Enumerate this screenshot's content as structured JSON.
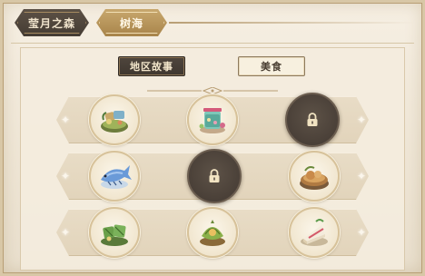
{
  "breadcrumb": {
    "level1": "莹月之森",
    "level2": "树海"
  },
  "tabs": {
    "story": "地区故事",
    "food": "美食",
    "active": "story"
  },
  "grid": {
    "rows": [
      [
        {
          "state": "unlocked",
          "icon": "herbal-dish-icon"
        },
        {
          "state": "unlocked",
          "icon": "jar-preserve-icon"
        },
        {
          "state": "locked",
          "icon": "lock-icon"
        }
      ],
      [
        {
          "state": "unlocked",
          "icon": "grilled-fish-icon"
        },
        {
          "state": "locked",
          "icon": "lock-icon"
        },
        {
          "state": "unlocked",
          "icon": "stew-pot-icon"
        }
      ],
      [
        {
          "state": "unlocked",
          "icon": "leaf-wrap-icon"
        },
        {
          "state": "unlocked",
          "icon": "bundle-dish-icon"
        },
        {
          "state": "unlocked",
          "icon": "cake-slice-icon"
        }
      ]
    ]
  },
  "colors": {
    "accent_gold": "#b8955a",
    "dark_tab": "#453c33",
    "locked_fill": "#4a4038"
  }
}
